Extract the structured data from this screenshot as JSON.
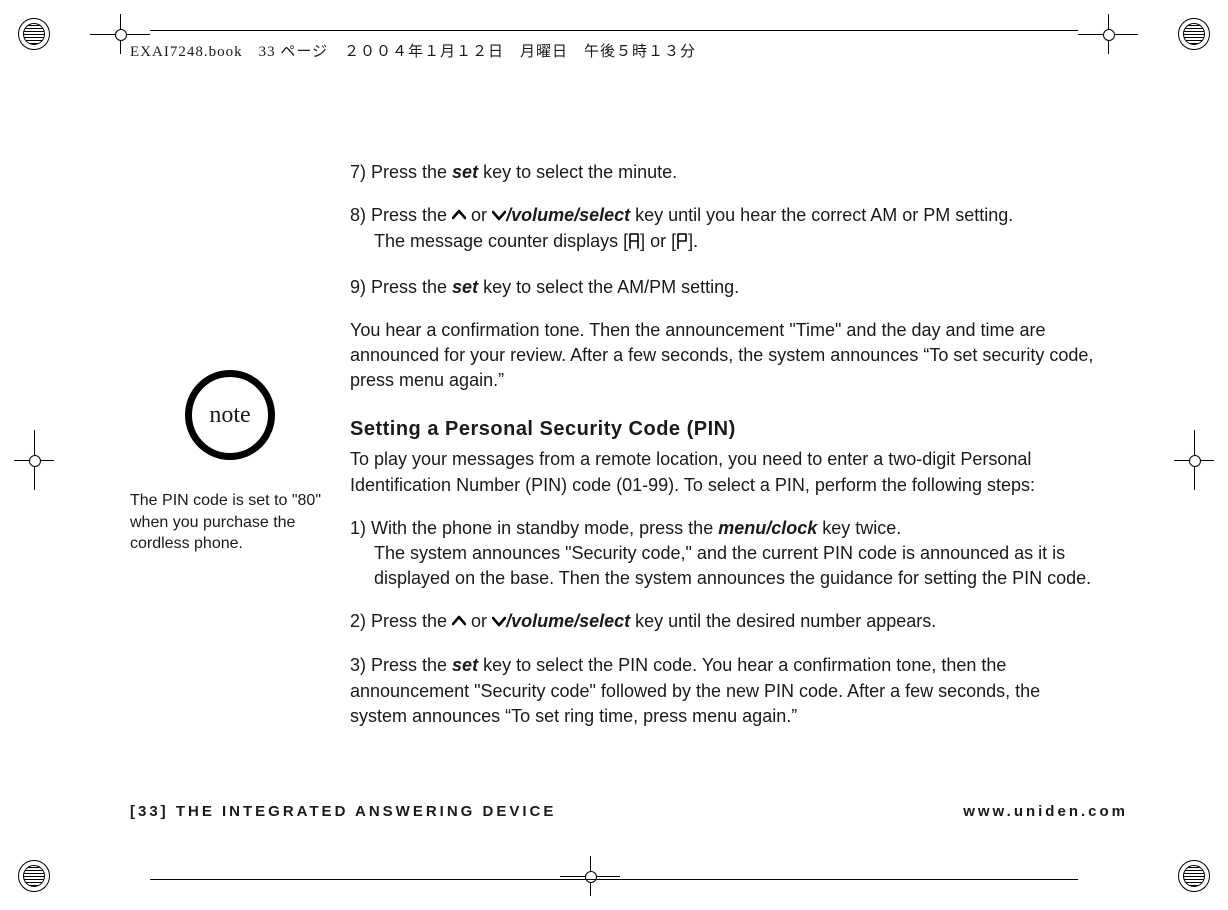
{
  "header_line": "EXAI7248.book　33 ページ　２００４年１月１２日　月曜日　午後５時１３分",
  "sidebar": {
    "note_label": "note",
    "note_text": "The PIN code is set to \"80\" when you purchase the cordless phone."
  },
  "body": {
    "step7_a": "7) Press the ",
    "set_key": "set",
    "step7_b": " key to select the minute.",
    "step8_a": "8) Press the ",
    "or": " or ",
    "vol_select": "/volume/select",
    "step8_b": " key until you hear the correct AM or PM setting.",
    "step8_c": "The message counter displays [",
    "step8_d": "] or [",
    "step8_e": "].",
    "step9_a": "9) Press the ",
    "step9_b": " key to select the AM/PM setting.",
    "confirm": "You hear a confirmation tone. Then the announcement \"Time\" and the day and time are announced for your review. After a few seconds, the system announces “To set security code, press menu again.”",
    "heading": "Setting a Personal Security Code (PIN)",
    "pin_intro": "To play your messages from a remote location, you need to enter a two-digit Personal Identification Number (PIN) code (01-99). To select a PIN, perform the following steps:",
    "pin1_a": "1) With the phone in standby mode, press the ",
    "menu_clock": "menu/clock",
    "pin1_b": " key twice.",
    "pin1_c": "The system announces \"Security code,\" and the current PIN code is announced as it is displayed on the base. Then the system announces the guidance for setting the PIN code.",
    "pin2_a": "2) Press the ",
    "pin2_b": " key until the desired number appears.",
    "pin3_a": "3) Press the ",
    "pin3_b": " key to select the PIN code. You hear a confirmation tone, then the announcement \"Security code\" followed by the new PIN code. After a few seconds, the system announces “To set ring time, press menu again.”"
  },
  "footer": {
    "left": "[33] THE INTEGRATED ANSWERING DEVICE",
    "right": "www.uniden.com"
  }
}
